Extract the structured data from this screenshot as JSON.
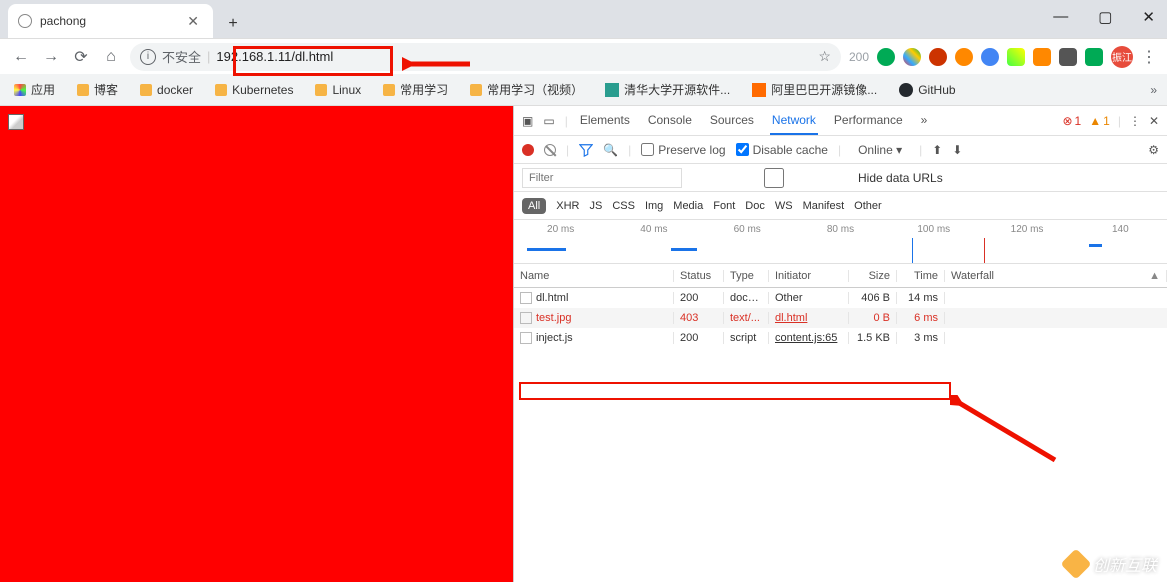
{
  "tab": {
    "title": "pachong"
  },
  "url": {
    "not_secure": "不安全",
    "value": "192.168.1.11/dl.html",
    "count": "200"
  },
  "avatar_text": "振江",
  "bookmarks": {
    "apps": "应用",
    "items": [
      "博客",
      "docker",
      "Kubernetes",
      "Linux",
      "常用学习",
      "常用学习（视频）",
      "清华大学开源软件...",
      "阿里巴巴开源镜像...",
      "GitHub"
    ]
  },
  "devtools": {
    "tabs": [
      "Elements",
      "Console",
      "Sources",
      "Network",
      "Performance"
    ],
    "active_tab": "Network",
    "errors": "1",
    "warnings": "1",
    "preserve": "Preserve log",
    "disable_cache": "Disable cache",
    "throttle": "Online",
    "filter_ph": "Filter",
    "hide_urls": "Hide data URLs",
    "types": [
      "All",
      "XHR",
      "JS",
      "CSS",
      "Img",
      "Media",
      "Font",
      "Doc",
      "WS",
      "Manifest",
      "Other"
    ],
    "timeline": [
      "20 ms",
      "40 ms",
      "60 ms",
      "80 ms",
      "100 ms",
      "120 ms",
      "140"
    ],
    "columns": [
      "Name",
      "Status",
      "Type",
      "Initiator",
      "Size",
      "Time",
      "Waterfall"
    ],
    "rows": [
      {
        "name": "dl.html",
        "status": "200",
        "type": "docu...",
        "initiator": "Other",
        "size": "406 B",
        "time": "14 ms",
        "err": false,
        "init_other": true
      },
      {
        "name": "test.jpg",
        "status": "403",
        "type": "text/...",
        "initiator": "dl.html",
        "size": "0 B",
        "time": "6 ms",
        "err": true
      },
      {
        "name": "inject.js",
        "status": "200",
        "type": "script",
        "initiator": "content.js:65",
        "size": "1.5 KB",
        "time": "3 ms",
        "err": false
      }
    ]
  },
  "watermark": "创新互联"
}
